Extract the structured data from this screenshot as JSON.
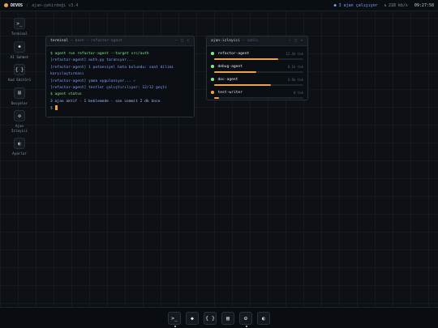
{
  "topbar": {
    "brand": "DEVOS",
    "separator": "/",
    "subtitle": "ajan-çekirdeği v3.4",
    "agents_running": "3 ajan çalışıyor",
    "network": "218 kb/s",
    "clock": "09:27:58"
  },
  "sidebar": {
    "items": [
      {
        "label": "Terminal",
        "icon": ">_"
      },
      {
        "label": "AI Sohbet",
        "icon": "◆"
      },
      {
        "label": "Kod Editörü",
        "icon": "{ }"
      },
      {
        "label": "Dosyalar",
        "icon": "▤"
      },
      {
        "label": "Ajan İzleyici",
        "icon": "⚙"
      },
      {
        "label": "Ayarlar",
        "icon": "◐"
      }
    ]
  },
  "terminal": {
    "title": "terminal",
    "subtitle": "— bash — refactor-agent",
    "controls": "– □ ×",
    "lines": [
      "$ agent run refactor-agent --target src/auth",
      "[refactor-agent] auth.py taranıyor...",
      "[refactor-agent] 1 potansiyel hata bulundu: saat dilimi karşılaştırması",
      "[refactor-agent] yama uygulanıyor... ✓",
      "[refactor-agent] testler çalıştırılıyor: 12/12 geçti",
      "$ agent status",
      "3 ajan aktif · 1 beklemede · son commit 2 dk önce",
      "$"
    ]
  },
  "monitor": {
    "title": "ajan-izleyici",
    "subtitle": "— canlı",
    "controls": "– □ ×",
    "agents": [
      {
        "name": "refactor-agent",
        "tokens": "12.4k tok",
        "status_color": "#7ee787",
        "progress": 0.72
      },
      {
        "name": "debug-agent",
        "tokens": "8.1k tok",
        "status_color": "#7ee787",
        "progress": 0.47
      },
      {
        "name": "doc-agent",
        "tokens": "3.9k tok",
        "status_color": "#7ee787",
        "progress": 0.64
      },
      {
        "name": "test-writer",
        "tokens": "0 tok",
        "status_color": "#f0a04b",
        "progress": 0.05
      }
    ]
  },
  "dock": {
    "items": [
      {
        "icon": ">_",
        "running": true
      },
      {
        "icon": "◆",
        "running": false
      },
      {
        "icon": "{ }",
        "running": false
      },
      {
        "icon": "▤",
        "running": false
      },
      {
        "icon": "⚙",
        "running": true
      },
      {
        "icon": "◐",
        "running": false
      }
    ]
  },
  "colors": {
    "accent": "#f0a04b",
    "ok": "#7ee787",
    "link": "#7aa2f7"
  }
}
